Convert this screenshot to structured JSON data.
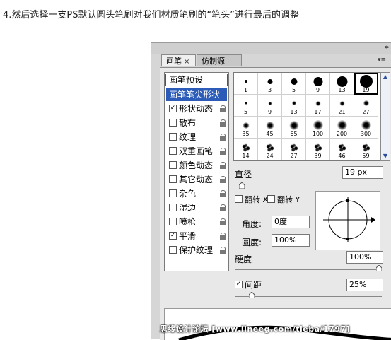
{
  "caption": "4.然后选择一支PS默认圆头笔刷对我们材质笔刷的“笔头”进行最后的调整",
  "panel": {
    "tabs": [
      {
        "label": "画笔",
        "close": "×",
        "active": true
      },
      {
        "label": "仿制源",
        "active": false
      }
    ],
    "collapse_glyph": "▸▸",
    "menu_glyph": "▾≡"
  },
  "options": {
    "preset_label": "画笔预设",
    "items": [
      {
        "label": "画笔笔尖形状",
        "checkbox": false,
        "checked": false,
        "selected": true,
        "locked": false
      },
      {
        "label": "形状动态",
        "checkbox": true,
        "checked": true,
        "selected": false,
        "locked": true
      },
      {
        "label": "散布",
        "checkbox": true,
        "checked": false,
        "selected": false,
        "locked": true
      },
      {
        "label": "纹理",
        "checkbox": true,
        "checked": false,
        "selected": false,
        "locked": true
      },
      {
        "label": "双重画笔",
        "checkbox": true,
        "checked": false,
        "selected": false,
        "locked": true
      },
      {
        "label": "颜色动态",
        "checkbox": true,
        "checked": false,
        "selected": false,
        "locked": true
      },
      {
        "label": "其它动态",
        "checkbox": true,
        "checked": false,
        "selected": false,
        "locked": true
      },
      {
        "label": "杂色",
        "checkbox": true,
        "checked": false,
        "selected": false,
        "locked": true
      },
      {
        "label": "湿边",
        "checkbox": true,
        "checked": false,
        "selected": false,
        "locked": true
      },
      {
        "label": "喷枪",
        "checkbox": true,
        "checked": false,
        "selected": false,
        "locked": true
      },
      {
        "label": "平滑",
        "checkbox": true,
        "checked": true,
        "selected": false,
        "locked": true
      },
      {
        "label": "保护纹理",
        "checkbox": true,
        "checked": false,
        "selected": false,
        "locked": true
      }
    ]
  },
  "brush_grid": {
    "rows": [
      [
        {
          "size": 1,
          "kind": "hard"
        },
        {
          "size": 3,
          "kind": "hard"
        },
        {
          "size": 5,
          "kind": "hard"
        },
        {
          "size": 9,
          "kind": "hard"
        },
        {
          "size": 13,
          "kind": "hard"
        },
        {
          "size": 19,
          "kind": "hard",
          "selected": true
        }
      ],
      [
        {
          "size": 5,
          "kind": "soft"
        },
        {
          "size": 9,
          "kind": "soft"
        },
        {
          "size": 13,
          "kind": "soft"
        },
        {
          "size": 17,
          "kind": "soft"
        },
        {
          "size": 21,
          "kind": "soft"
        },
        {
          "size": 27,
          "kind": "soft"
        }
      ],
      [
        {
          "size": 35,
          "kind": "soft"
        },
        {
          "size": 45,
          "kind": "soft"
        },
        {
          "size": 65,
          "kind": "soft"
        },
        {
          "size": 100,
          "kind": "soft"
        },
        {
          "size": 200,
          "kind": "soft"
        },
        {
          "size": 300,
          "kind": "soft"
        }
      ],
      [
        {
          "size": 14,
          "kind": "spatter"
        },
        {
          "size": 24,
          "kind": "spatter"
        },
        {
          "size": 27,
          "kind": "spatter"
        },
        {
          "size": 39,
          "kind": "spatter"
        },
        {
          "size": 46,
          "kind": "spatter"
        },
        {
          "size": 59,
          "kind": "spatter"
        }
      ]
    ]
  },
  "diameter": {
    "label": "直径",
    "value": "19 px",
    "slider": 0.03
  },
  "flip": {
    "x_label": "翻转 X",
    "y_label": "翻转 Y",
    "x_checked": false,
    "y_checked": false
  },
  "angle": {
    "label": "角度:",
    "value": "0度"
  },
  "roundness": {
    "label": "圆度:",
    "value": "100%"
  },
  "hardness": {
    "label": "硬度",
    "value": "100%",
    "slider": 1.0
  },
  "spacing": {
    "label": "间距",
    "value": "25%",
    "checked": true,
    "slider": 0.1
  },
  "watermark": "思缘设计论坛 [www.lineeg.com/tieba/1797]",
  "colors": {
    "selected_bg": "#2c5cb8",
    "panel_bg": "#d6d6d6",
    "body_bg": "#e8e8e8"
  }
}
